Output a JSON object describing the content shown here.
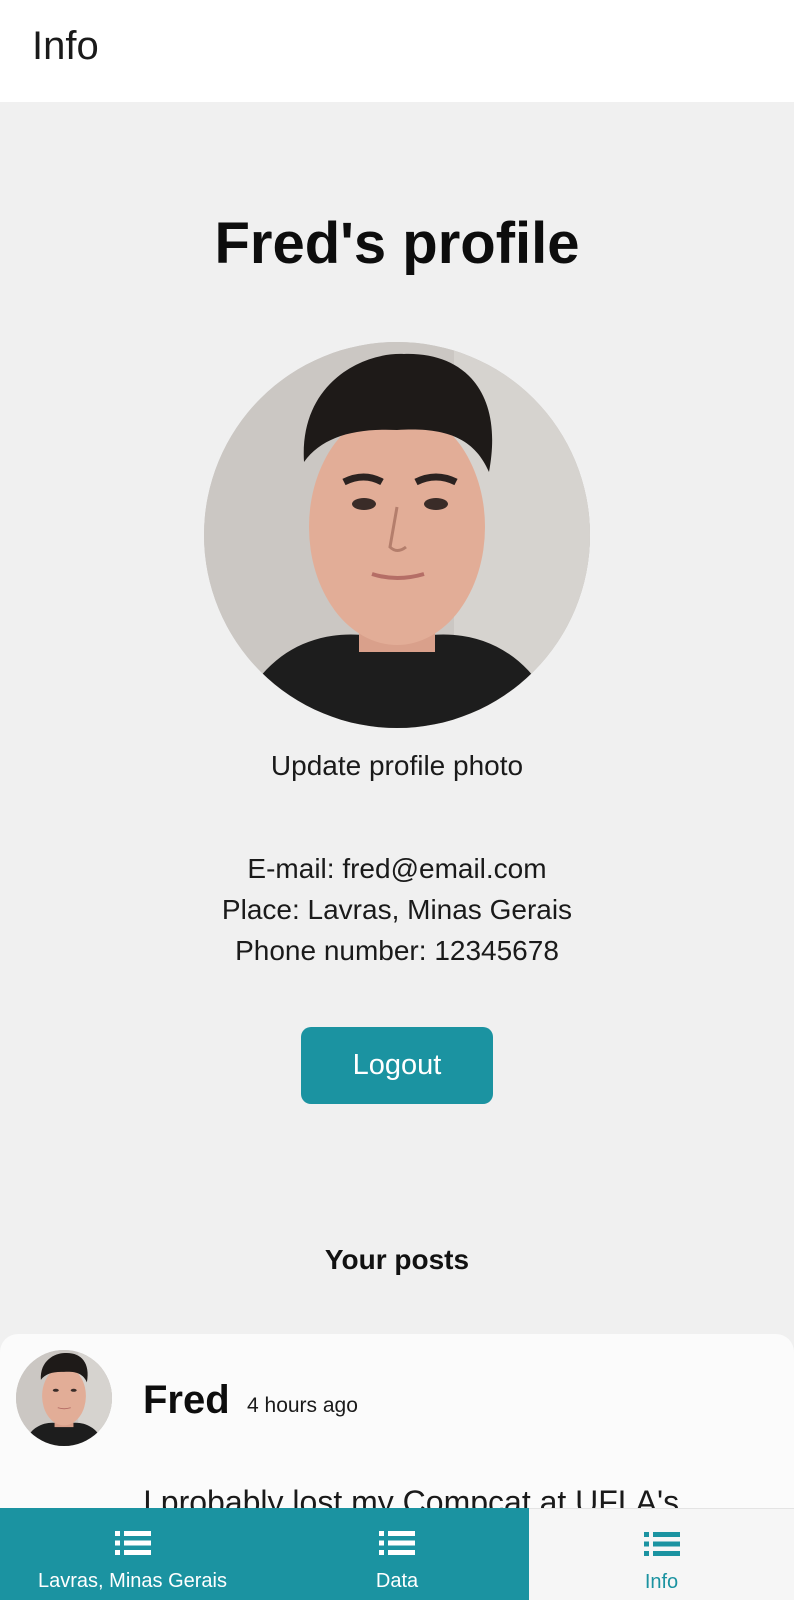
{
  "header": {
    "title": "Info"
  },
  "profile": {
    "title": "Fred's profile",
    "update_photo_label": "Update profile photo",
    "email_line": "E-mail: fred@email.com",
    "place_line": "Place: Lavras, Minas Gerais",
    "phone_line": "Phone number: 12345678",
    "logout_label": "Logout"
  },
  "posts": {
    "heading": "Your posts",
    "items": [
      {
        "author": "Fred",
        "time": "4 hours ago",
        "text": "I probably lost my Compcat at UFLA's"
      }
    ]
  },
  "nav": {
    "items": [
      {
        "label": "Lavras, Minas Gerais",
        "icon": "list-icon",
        "active": false
      },
      {
        "label": "Data",
        "icon": "list-icon",
        "active": false
      },
      {
        "label": "Info",
        "icon": "list-icon",
        "active": true
      }
    ]
  },
  "colors": {
    "accent": "#1b93a1",
    "background": "#f0f0f0",
    "header_bg": "#ffffff"
  }
}
